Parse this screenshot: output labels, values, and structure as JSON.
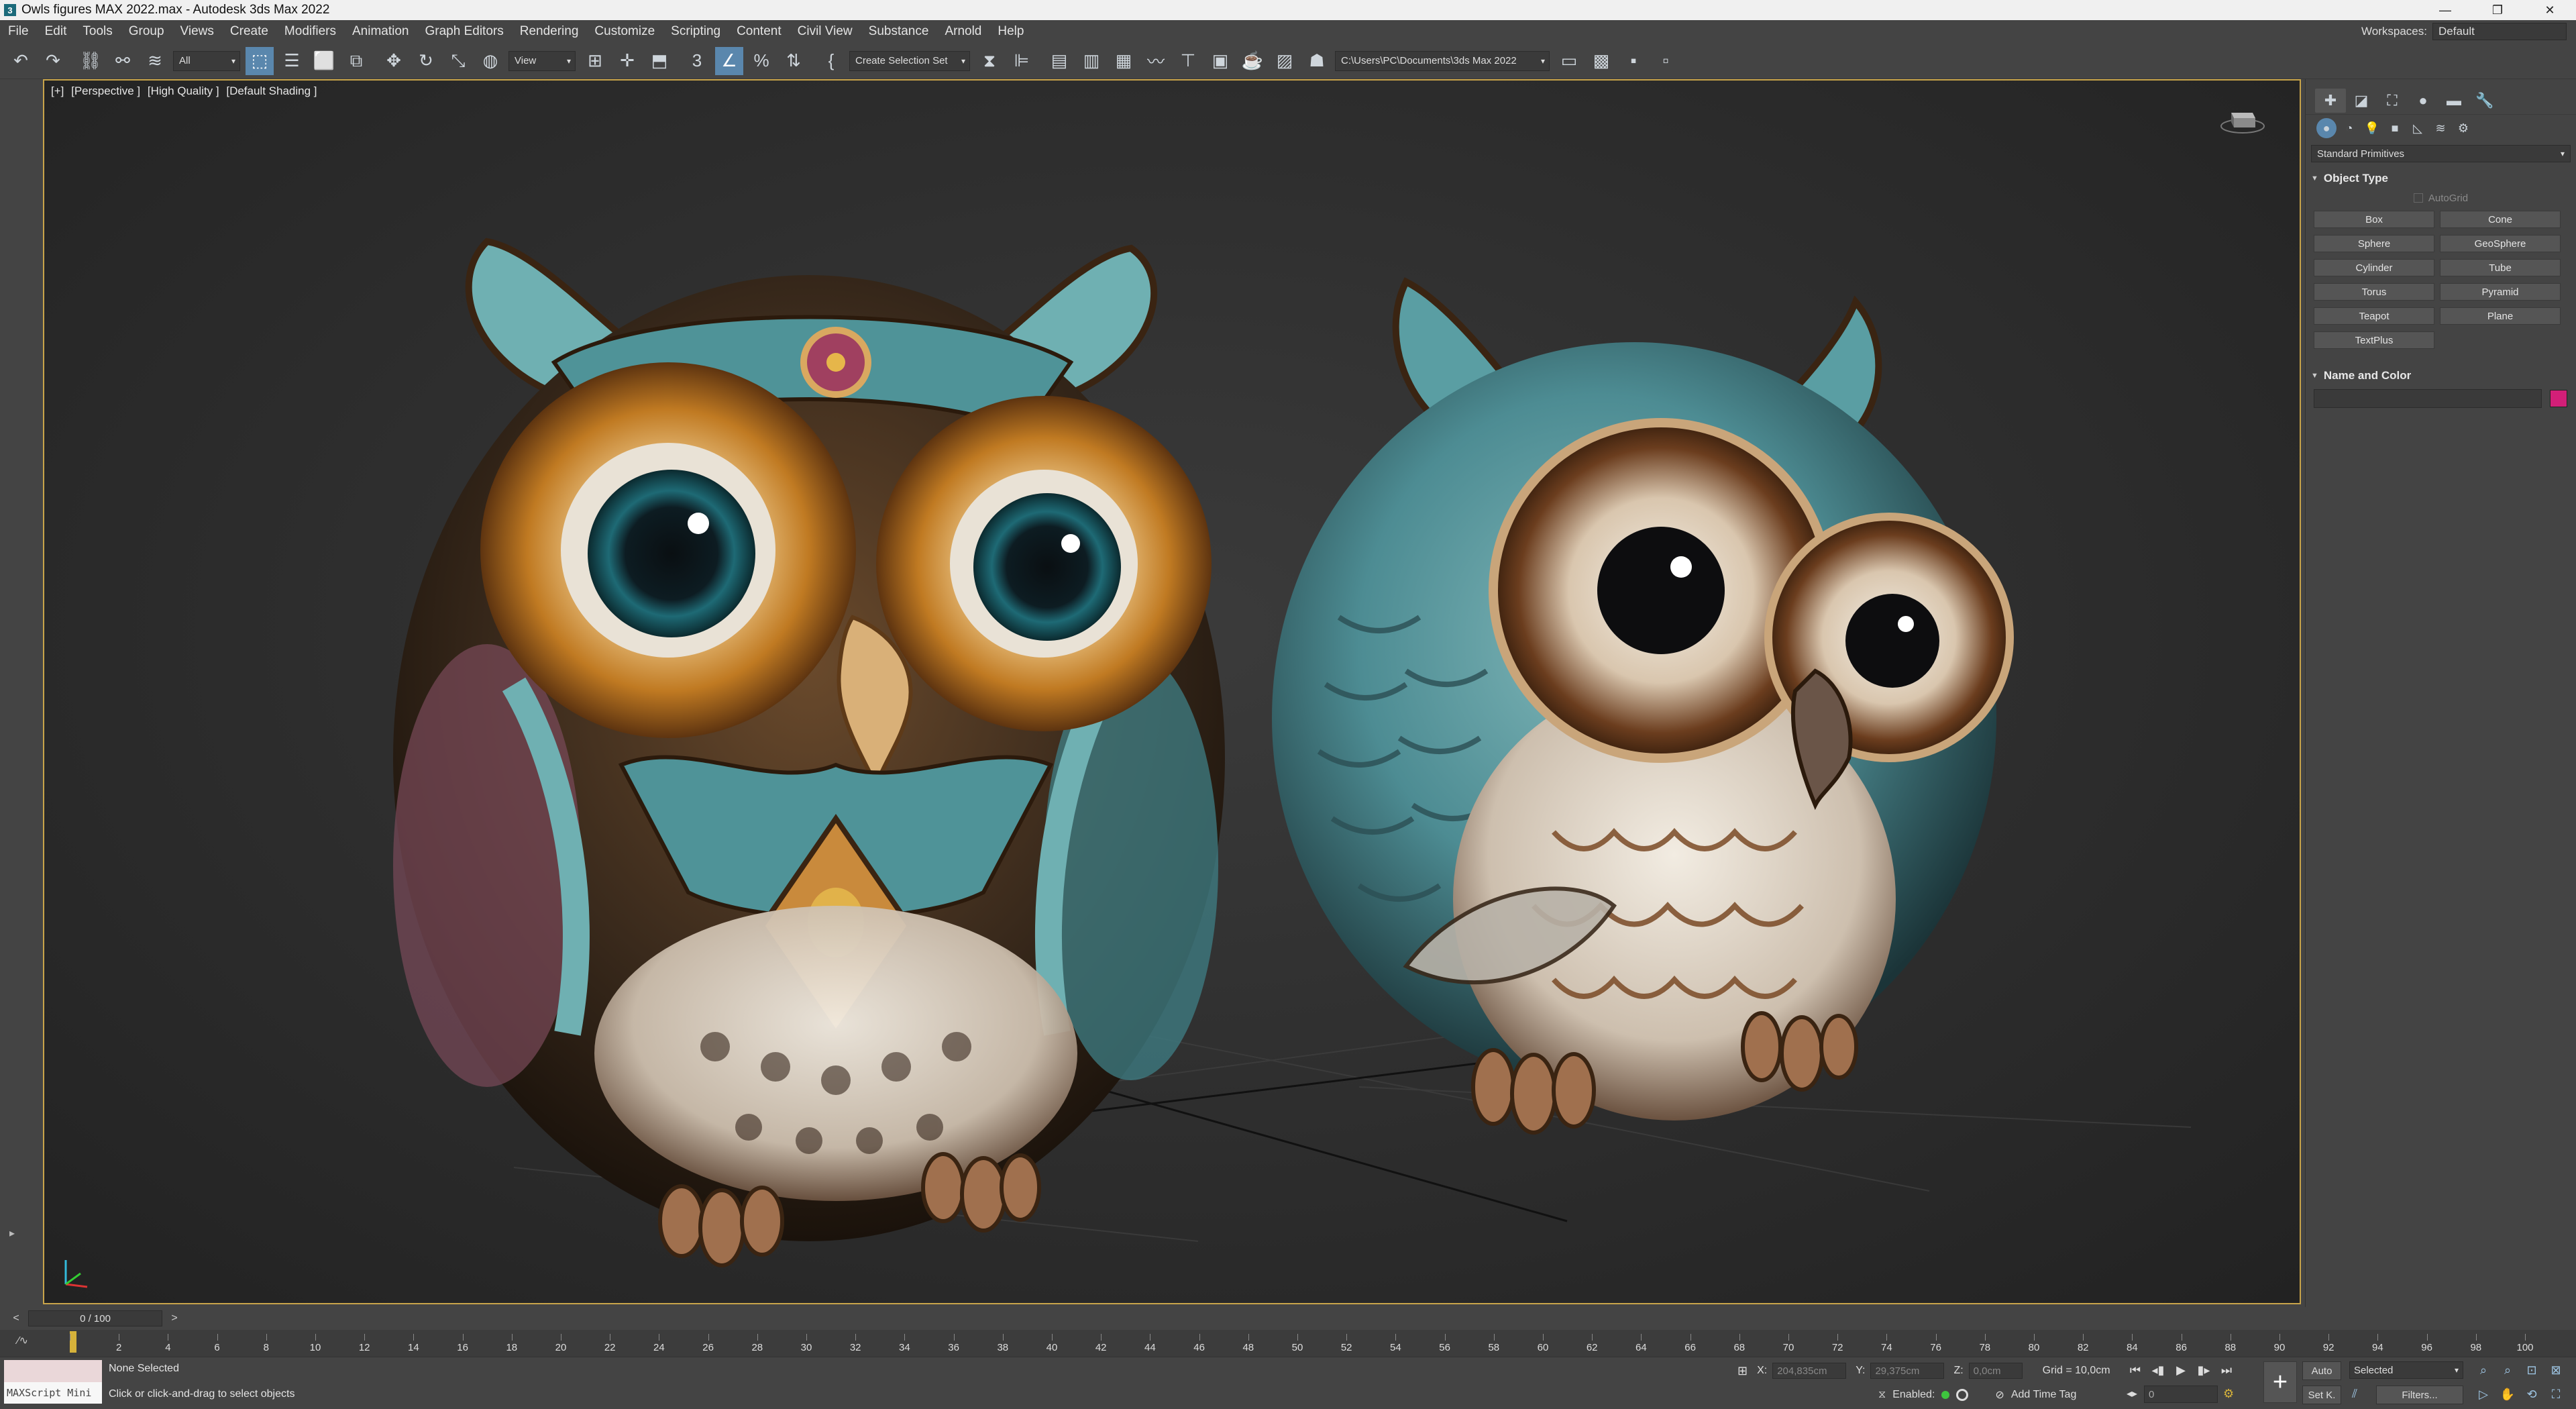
{
  "window": {
    "title": "Owls figures MAX 2022.max - Autodesk 3ds Max 2022",
    "controls": [
      "—",
      "❐",
      "✕"
    ]
  },
  "menu": {
    "items": [
      "File",
      "Edit",
      "Tools",
      "Group",
      "Views",
      "Create",
      "Modifiers",
      "Animation",
      "Graph Editors",
      "Rendering",
      "Customize",
      "Scripting",
      "Content",
      "Civil View",
      "Substance",
      "Arnold",
      "Help"
    ],
    "workspaces_label": "Workspaces:",
    "workspace_value": "Default"
  },
  "toolbar": {
    "selection_filter": "All",
    "ref_coord": "View",
    "named_selection": "Create Selection Set",
    "project_path": "C:\\Users\\PC\\Documents\\3ds Max 2022",
    "icons": [
      "undo-icon",
      "redo-icon",
      "link-icon",
      "unlink-icon",
      "bind-spacewarp-icon",
      "select-object-icon",
      "select-by-name-icon",
      "rect-region-icon",
      "window-crossing-icon",
      "move-icon",
      "rotate-icon",
      "scale-icon",
      "place-icon",
      "snap-3d-icon",
      "angle-snap-icon",
      "percent-snap-icon",
      "spinner-snap-icon",
      "mirror-icon",
      "align-icon",
      "scene-explorer-icon",
      "layer-explorer-icon",
      "toggle-ribbon-icon",
      "curve-editor-icon",
      "schematic-view-icon",
      "material-editor-icon",
      "render-setup-icon",
      "rendered-frame-icon",
      "render-icon"
    ]
  },
  "viewport": {
    "labels": [
      "[+]",
      "[Perspective ]",
      "[High Quality ]",
      "[Default Shading ]"
    ]
  },
  "command_panel": {
    "tabs": [
      "create-tab-icon",
      "modify-tab-icon",
      "hierarchy-tab-icon",
      "motion-tab-icon",
      "display-tab-icon",
      "utilities-tab-icon"
    ],
    "subtabs": [
      "geometry-icon",
      "shapes-icon",
      "lights-icon",
      "cameras-icon",
      "helpers-icon",
      "spacewarps-icon",
      "systems-icon"
    ],
    "category": "Standard Primitives",
    "object_type_title": "Object Type",
    "autogrid": "AutoGrid",
    "primitives": [
      "Box",
      "Cone",
      "Sphere",
      "GeoSphere",
      "Cylinder",
      "Tube",
      "Torus",
      "Pyramid",
      "Teapot",
      "Plane",
      "TextPlus"
    ],
    "name_color_title": "Name and Color",
    "object_color": "#d31f78"
  },
  "timeline": {
    "frame_readout": "0 / 100",
    "prev": "<",
    "next": ">",
    "ticks": [
      0,
      2,
      4,
      6,
      8,
      10,
      12,
      14,
      16,
      18,
      20,
      22,
      24,
      26,
      28,
      30,
      32,
      34,
      36,
      38,
      40,
      42,
      44,
      46,
      48,
      50,
      52,
      54,
      56,
      58,
      60,
      62,
      64,
      66,
      68,
      70,
      72,
      74,
      76,
      78,
      80,
      82,
      84,
      86,
      88,
      90,
      92,
      94,
      96,
      98,
      100
    ],
    "tick_labels": [
      "2",
      "4",
      "6",
      "8",
      "10",
      "12",
      "14",
      "16",
      "18",
      "20",
      "22",
      "24",
      "26",
      "28",
      "30",
      "32",
      "34",
      "36",
      "38",
      "40",
      "42",
      "44",
      "46",
      "48",
      "50",
      "52",
      "54",
      "56",
      "58",
      "60",
      "62",
      "64",
      "66",
      "68",
      "70",
      "72",
      "74",
      "76",
      "78",
      "80",
      "82",
      "84",
      "86",
      "88",
      "90",
      "92",
      "94",
      "96",
      "98",
      "100"
    ],
    "current_frame": 0
  },
  "status": {
    "maxscript": "MAXScript Mini",
    "selection": "None Selected",
    "prompt": "Click or click-and-drag to select objects",
    "x_label": "X:",
    "x_value": "204,835cm",
    "y_label": "Y:",
    "y_value": "29,375cm",
    "z_label": "Z:",
    "z_value": "0,0cm",
    "grid": "Grid = 10,0cm",
    "enabled": "Enabled:",
    "add_time_tag": "Add Time Tag",
    "auto": "Auto",
    "set_key": "Set K.",
    "key_filter": "Selected",
    "filters": "Filters...",
    "frame_field": "0"
  },
  "colors": {
    "accent_blue": "#5a87ad",
    "viewport_border": "#c8a44a",
    "time_cursor": "#d6b23a"
  }
}
